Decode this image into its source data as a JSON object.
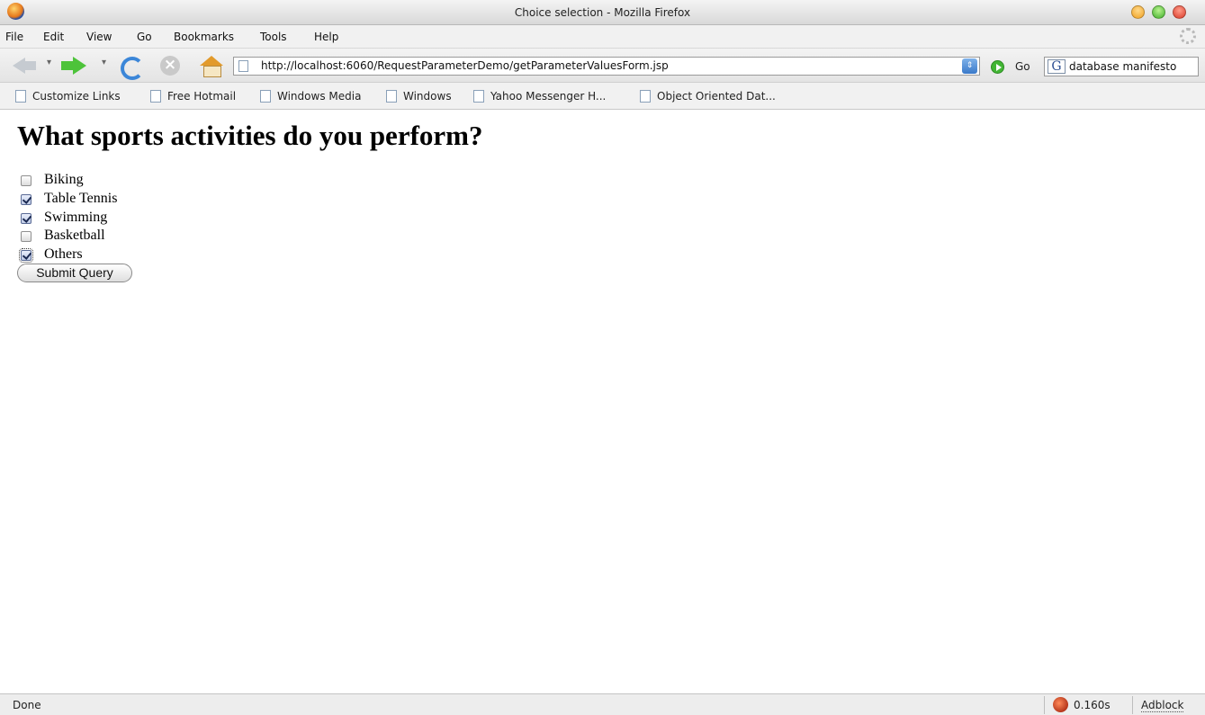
{
  "window": {
    "title": "Choice selection - Mozilla Firefox"
  },
  "menu": {
    "items": [
      "File",
      "Edit",
      "View",
      "Go",
      "Bookmarks",
      "Tools",
      "Help"
    ]
  },
  "navigation": {
    "url": "http://localhost:6060/RequestParameterDemo/getParameterValuesForm.jsp",
    "go_label": "Go",
    "search_value": "database manifesto",
    "icons": [
      "back-icon",
      "forward-icon",
      "reload-icon",
      "stop-icon",
      "home-icon",
      "go-icon"
    ]
  },
  "bookmarks": {
    "items": [
      "Customize Links",
      "Free Hotmail",
      "Windows Media",
      "Windows",
      "Yahoo Messenger H...",
      "Object Oriented Dat..."
    ]
  },
  "page": {
    "heading": "What sports activities do you perform?",
    "choices": [
      {
        "label": "Biking",
        "checked": false
      },
      {
        "label": "Table Tennis",
        "checked": true
      },
      {
        "label": "Swimming",
        "checked": true
      },
      {
        "label": "Basketball",
        "checked": false
      },
      {
        "label": "Others",
        "checked": true
      }
    ],
    "submit_label": "Submit Query"
  },
  "status": {
    "text": "Done",
    "timer": "0.160s",
    "adblock": "Adblock"
  }
}
